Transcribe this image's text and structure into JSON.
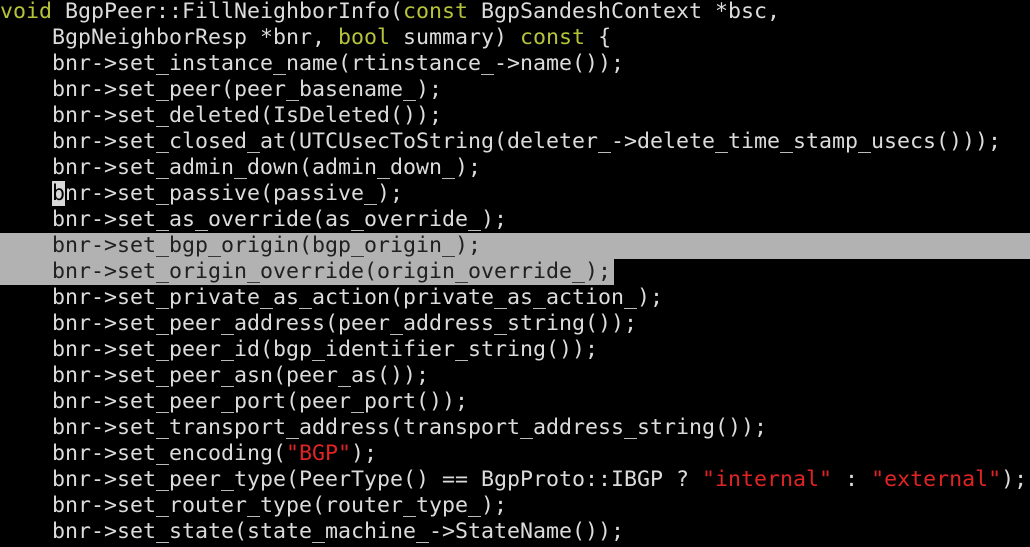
{
  "editor": {
    "colors": {
      "background": "#000000",
      "text": "#dcdcdc",
      "keyword": "#b5c33a",
      "string": "#e02424",
      "selection": "#b2b2b2",
      "cursor": "#d8d8d8"
    },
    "lines": [
      {
        "parts": [
          {
            "t": "void",
            "c": "kw"
          },
          {
            "t": " BgpPeer::FillNeighborInfo("
          },
          {
            "t": "const",
            "c": "kw"
          },
          {
            "t": " BgpSandeshContext *bsc,"
          }
        ]
      },
      {
        "parts": [
          {
            "t": "    BgpNeighborResp *bnr, "
          },
          {
            "t": "bool",
            "c": "kw"
          },
          {
            "t": " summary) "
          },
          {
            "t": "const",
            "c": "kw"
          },
          {
            "t": " {"
          }
        ]
      },
      {
        "parts": [
          {
            "t": "    bnr->set_instance_name(rtinstance_->name());"
          }
        ]
      },
      {
        "parts": [
          {
            "t": "    bnr->set_peer(peer_basename_);"
          }
        ]
      },
      {
        "parts": [
          {
            "t": "    bnr->set_deleted(IsDeleted());"
          }
        ]
      },
      {
        "parts": [
          {
            "t": "    bnr->set_closed_at(UTCUsecToString(deleter_->delete_time_stamp_usecs()));"
          }
        ]
      },
      {
        "parts": [
          {
            "t": "    bnr->set_admin_down(admin_down_);"
          }
        ]
      },
      {
        "parts": [
          {
            "t": "    "
          },
          {
            "t": "b",
            "c": "cursor"
          },
          {
            "t": "nr->set_passive(passive_);"
          }
        ]
      },
      {
        "parts": [
          {
            "t": "    bnr->set_as_override(as_override_);"
          }
        ]
      },
      {
        "sel": "full",
        "parts": [
          {
            "t": "    bnr->set_bgp_origin(bgp_origin_);"
          }
        ]
      },
      {
        "sel": "short",
        "parts": [
          {
            "t": "    bnr->set_origin_override(origin_override_);"
          }
        ]
      },
      {
        "parts": [
          {
            "t": "    bnr->set_private_as_action(private_as_action_);"
          }
        ]
      },
      {
        "parts": [
          {
            "t": "    bnr->set_peer_address(peer_address_string());"
          }
        ]
      },
      {
        "parts": [
          {
            "t": "    bnr->set_peer_id(bgp_identifier_string());"
          }
        ]
      },
      {
        "parts": [
          {
            "t": "    bnr->set_peer_asn(peer_as());"
          }
        ]
      },
      {
        "parts": [
          {
            "t": "    bnr->set_peer_port(peer_port());"
          }
        ]
      },
      {
        "parts": [
          {
            "t": "    bnr->set_transport_address(transport_address_string());"
          }
        ]
      },
      {
        "parts": [
          {
            "t": "    bnr->set_encoding("
          },
          {
            "t": "\"BGP\"",
            "c": "str"
          },
          {
            "t": ");"
          }
        ]
      },
      {
        "parts": [
          {
            "t": "    bnr->set_peer_type(PeerType() == BgpProto::IBGP ? "
          },
          {
            "t": "\"internal\"",
            "c": "str"
          },
          {
            "t": " : "
          },
          {
            "t": "\"external\"",
            "c": "str"
          },
          {
            "t": ");"
          }
        ]
      },
      {
        "parts": [
          {
            "t": "    bnr->set_router_type(router_type_);"
          }
        ]
      },
      {
        "parts": [
          {
            "t": "    bnr->set_state(state_machine_->StateName());"
          }
        ]
      }
    ]
  }
}
